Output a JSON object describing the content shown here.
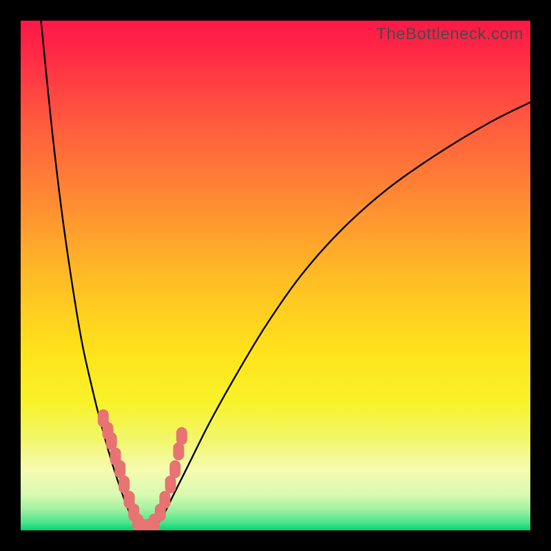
{
  "watermark": "TheBottleneck.com",
  "colors": {
    "frame": "#000000",
    "gradient_stops": [
      {
        "offset": 0.0,
        "color": "#ff1846"
      },
      {
        "offset": 0.07,
        "color": "#ff2b46"
      },
      {
        "offset": 0.2,
        "color": "#ff5a3e"
      },
      {
        "offset": 0.35,
        "color": "#ff8a33"
      },
      {
        "offset": 0.5,
        "color": "#ffbb26"
      },
      {
        "offset": 0.65,
        "color": "#ffe31a"
      },
      {
        "offset": 0.75,
        "color": "#f8f22a"
      },
      {
        "offset": 0.82,
        "color": "#f2f76a"
      },
      {
        "offset": 0.88,
        "color": "#f6fbb0"
      },
      {
        "offset": 0.93,
        "color": "#d9fab0"
      },
      {
        "offset": 0.96,
        "color": "#9ef0a0"
      },
      {
        "offset": 0.985,
        "color": "#4be38a"
      },
      {
        "offset": 1.0,
        "color": "#00d573"
      }
    ],
    "curve_stroke": "#000000",
    "marker_fill": "#e77373",
    "marker_stroke": "#c25a5a"
  },
  "chart_data": {
    "type": "line",
    "title": "",
    "xlabel": "",
    "ylabel": "",
    "xlim": [
      0,
      100
    ],
    "ylim": [
      0,
      100
    ],
    "grid": false,
    "series": [
      {
        "name": "left-branch",
        "x": [
          4,
          6,
          8,
          10,
          12,
          14,
          16,
          18,
          20,
          22,
          23.3
        ],
        "y": [
          100,
          80,
          63,
          49,
          37,
          28,
          20,
          13,
          7,
          2,
          0
        ]
      },
      {
        "name": "right-branch",
        "x": [
          26,
          28,
          30,
          33,
          37,
          42,
          48,
          55,
          63,
          72,
          82,
          92,
          100
        ],
        "y": [
          0,
          3,
          7,
          13,
          21,
          30,
          40,
          50,
          59,
          67,
          74,
          80,
          84
        ]
      }
    ],
    "markers": {
      "name": "highlight-points",
      "x": [
        16.2,
        17.1,
        17.8,
        18.6,
        19.5,
        20.3,
        21.3,
        22.2,
        23.0,
        24.0,
        25.2,
        26.2,
        27.4,
        28.3,
        29.4,
        30.3,
        31.0,
        31.6
      ],
      "y": [
        22.0,
        19.5,
        17.5,
        14.5,
        12.0,
        9.0,
        6.0,
        3.5,
        1.5,
        0.5,
        0.5,
        1.5,
        3.5,
        6.0,
        9.0,
        12.0,
        15.5,
        18.5
      ]
    }
  }
}
